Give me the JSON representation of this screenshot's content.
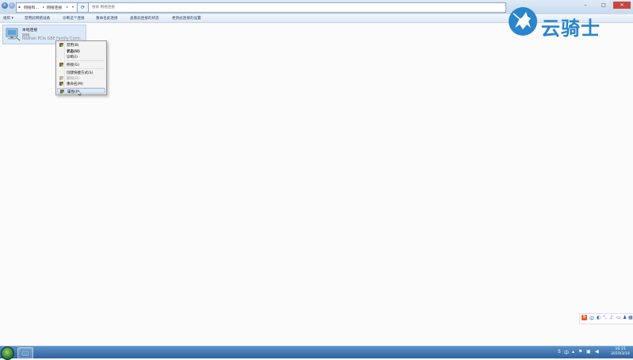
{
  "address_bar": {
    "breadcrumbs": [
      "网络和...",
      "网络连接"
    ],
    "search_placeholder": "搜索 网络连接"
  },
  "command_bar": {
    "items": [
      "组织 ▾",
      "禁用此网络设备",
      "诊断这个连接",
      "重命名此连接",
      "查看此连接的状态",
      "更改此连接的设置"
    ]
  },
  "connection": {
    "name": "本地连接",
    "status": "网络",
    "adapter": "Realtek PCIe GBE Family Contr..."
  },
  "context_menu": {
    "items": [
      {
        "label": "禁用(B)",
        "style": "normal",
        "icon": "shield-icon"
      },
      {
        "label": "状态(U)",
        "style": "bold",
        "icon": ""
      },
      {
        "label": "诊断(I)",
        "style": "normal",
        "icon": ""
      },
      {
        "label": "桥接(G)",
        "style": "normal",
        "icon": "shield-icon"
      },
      {
        "label": "创建快捷方式(S)",
        "style": "normal",
        "icon": ""
      },
      {
        "label": "删除(D)",
        "style": "disabled",
        "icon": "shield-icon"
      },
      {
        "label": "重命名(M)",
        "style": "normal",
        "icon": "shield-icon"
      },
      {
        "label": "属性(R)",
        "style": "hover",
        "icon": "shield-icon"
      }
    ]
  },
  "watermark": {
    "text": "云骑士"
  },
  "ime_bar": {
    "label": "中"
  },
  "taskbar": {
    "time": "16:15",
    "date": "2019/3/19"
  },
  "colors": {
    "accent": "#2a85cc",
    "taskbar": "#2f63a0",
    "selection": "#dce9f8"
  }
}
